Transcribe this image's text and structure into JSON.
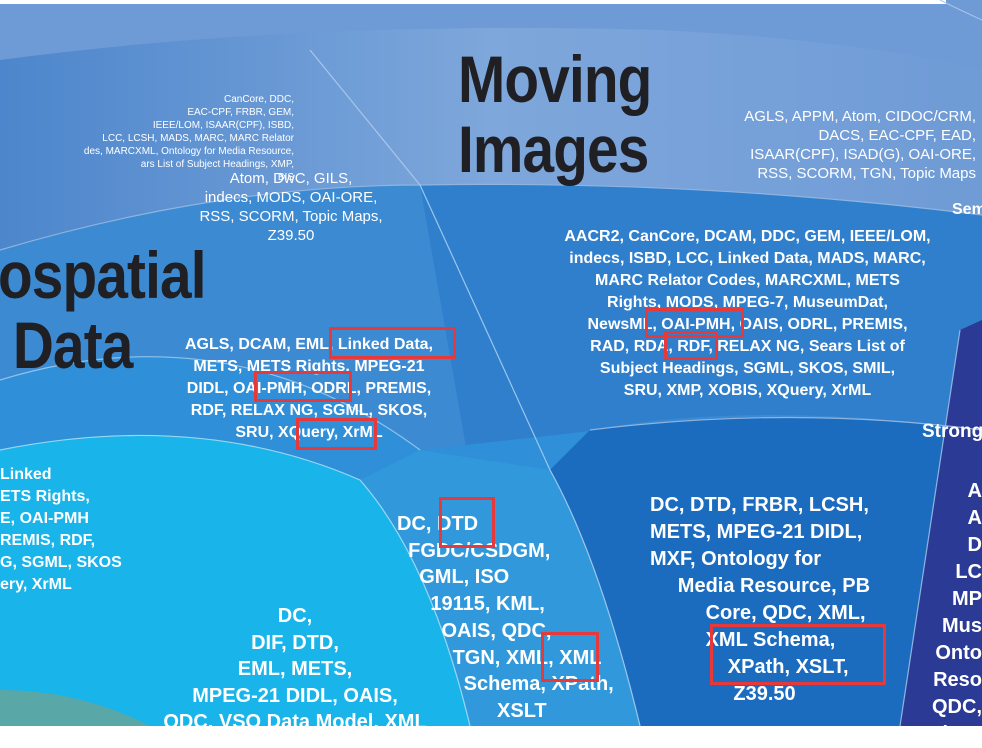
{
  "headings": {
    "moving_images": "Moving\nImages",
    "geospatial": "ospatial\n Data"
  },
  "labels": {
    "topleft_light": "CanCore, DDC,\nEAC-CPF, FRBR, GEM,\nIEEE/LOM, ISAAR(CPF), ISBD,\nLCC, LCSH, MADS, MARC, MARC Relator\ndes, MARCXML, Ontology for Media Resource,\nars List of Subject Headings, XMP,\nBIS",
    "geo_light": "Atom, DwC, GILS,\nindecs, MODS, OAI-ORE,\nRSS, SCORM, Topic Maps,\nZ39.50",
    "mi_light": "AGLS, APPM, Atom, CIDOC/CRM,\nDACS, EAC-CPF, EAD,\nISAAR(CPF), ISAD(G), OAI-ORE,\nRSS, SCORM, TGN, Topic Maps",
    "mi_mid": "AACR2, CanCore, DCAM, DDC, GEM, IEEE/LOM,\nindecs, ISBD, LCC, Linked Data, MADS, MARC,\nMARC Relator Codes, MARCXML, METS\nRights, MODS, MPEG-7, MuseumDat,\nNewsML, OAI-PMH, OAIS, ODRL, PREMIS,\nRAD, RDA, RDF, RELAX NG, Sears List of\nSubject Headings, SGML, SKOS, SMIL,\nSRU, XMP, XOBIS, XQuery, XrML",
    "geo_mid": "AGLS, DCAM, EML, Linked Data,\nMETS, METS Rights, MPEG-21\nDIDL, OAI-PMH, ODRL, PREMIS,\nRDF, RELAX NG, SGML, SKOS,\nSRU, XQuery, XrML",
    "left_mid": "Linked\nETS Rights,\nE, OAI-PMH\nREMIS, RDF,\nG, SGML, SKOS\nery, XrML",
    "geo_strong": "DC, DTD\n  FGDC/CSDGM,\n    GML, ISO\n      19115, KML,\n        OAIS, QDC,\n          TGN, XML, XML\n            Schema, XPath,\n                  XSLT",
    "mi_strong": "DC, DTD, FRBR, LCSH,\nMETS, MPEG-21 DIDL,\nMXF, Ontology for\n     Media Resource, PB\n          Core, QDC, XML,\n          XML Schema,\n              XPath, XSLT,\n               Z39.50",
    "left_strong": "DC,\nDIF, DTD,\nEML, METS,\nMPEG-21 DIDL, OAIS,\nQDC, VSO Data Model, XML",
    "right_col": "A\nA\nD\nLC\nMP\nMus\nOnto\nReso\nQDC,\nSchem",
    "edge_sem": "Sem",
    "edge_strong": "Strong"
  },
  "colors": {
    "outer_band": "#7aa2d8",
    "mid_band": "#3f8fd6",
    "inner_band": "#1a7ec9",
    "core_band": "#1ab6ea",
    "right_dark": "#2e3c96",
    "highlight": "#e8393a",
    "heading": "#1f1f24"
  }
}
